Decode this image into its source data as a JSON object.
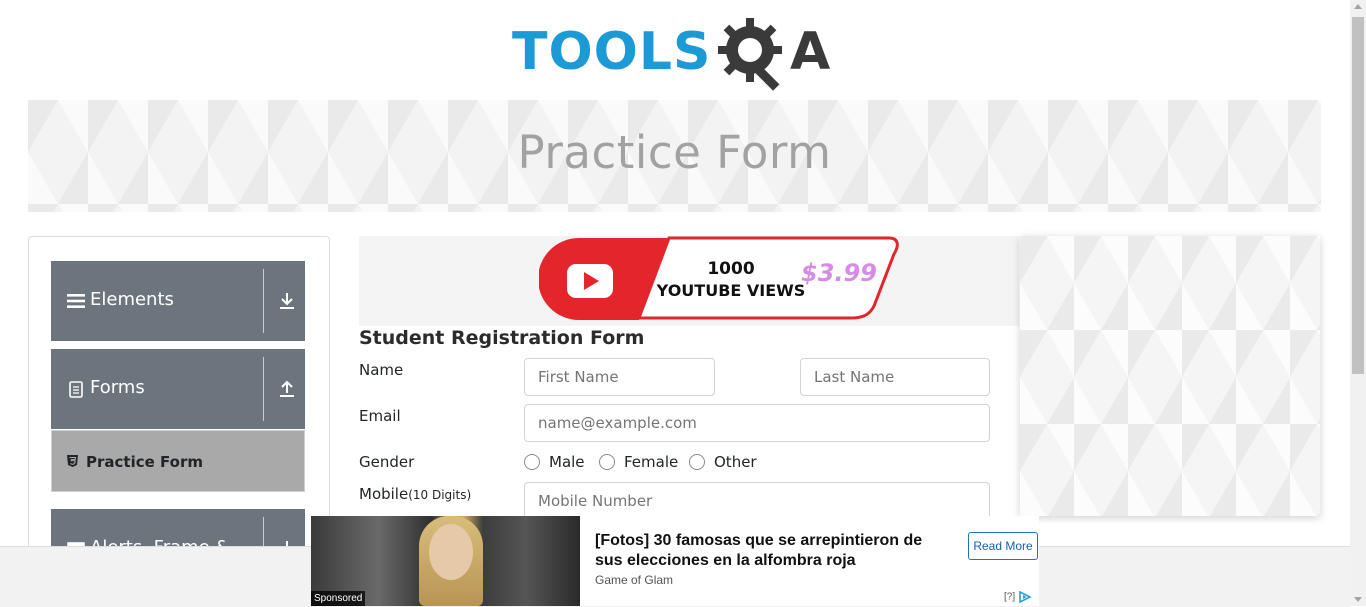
{
  "logo": {
    "text_tools": "TOOLS",
    "text_a": "A"
  },
  "banner": {
    "title": "Practice Form"
  },
  "sidebar": {
    "groups": [
      {
        "label": "Elements",
        "icon": "hamburger-icon",
        "arrow": "download-arrow-icon"
      },
      {
        "label": "Forms",
        "icon": "document-icon",
        "arrow": "upload-arrow-icon"
      },
      {
        "label": "Alerts, Frame & Windows",
        "icon": "window-icon",
        "arrow": "download-arrow-icon"
      }
    ],
    "active_item": {
      "label": "Practice Form",
      "icon": "html5-icon"
    }
  },
  "top_ad": {
    "line1": "1000",
    "line2": "YOUTUBE VIEWS",
    "price": "$3.99"
  },
  "form": {
    "title": "Student Registration Form",
    "name_label": "Name",
    "first_name_placeholder": "First Name",
    "last_name_placeholder": "Last Name",
    "email_label": "Email",
    "email_placeholder": "name@example.com",
    "gender_label": "Gender",
    "gender_options": [
      "Male",
      "Female",
      "Other"
    ],
    "mobile_label": "Mobile",
    "mobile_hint": "(10 Digits)",
    "mobile_placeholder": "Mobile Number"
  },
  "bottom_ad": {
    "sponsored": "Sponsored",
    "headline": "[Fotos] 30 famosas que se arrepintieron de sus elecciones en la alfombra roja",
    "source": "Game of Glam",
    "read_more": "Read More",
    "adchoices": "[?]"
  },
  "colors": {
    "brand_blue": "#1b9ad6",
    "sidebar_gray": "#6c757d",
    "active_gray": "#a9a9a9",
    "ad_red": "#e3262b"
  }
}
